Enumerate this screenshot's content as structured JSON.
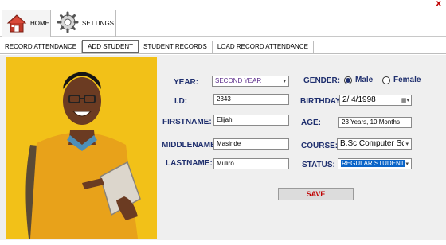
{
  "window": {
    "close_glyph": "x"
  },
  "ribbon": {
    "tabs": [
      {
        "label": "HOME",
        "icon": "house-icon"
      },
      {
        "label": "SETTINGS",
        "icon": "gear-icon"
      }
    ]
  },
  "subtabs": [
    {
      "label": "RECORD ATTENDANCE"
    },
    {
      "label": "ADD STUDENT",
      "active": true
    },
    {
      "label": "STUDENT RECORDS"
    },
    {
      "label": "LOAD RECORD ATTENDANCE"
    }
  ],
  "form": {
    "year": {
      "label": "YEAR:",
      "value": "SECOND YEAR"
    },
    "id": {
      "label": "I.D:",
      "value": "2343"
    },
    "firstname": {
      "label": "FIRSTNAME:",
      "value": "Elijah"
    },
    "middlename": {
      "label": "MIDDLENAME:",
      "value": "Masinde"
    },
    "lastname": {
      "label": "LASTNAME:",
      "value": "Muliro"
    },
    "gender": {
      "label": "GENDER:",
      "options": [
        "Male",
        "Female"
      ],
      "selected": "Male"
    },
    "birthday": {
      "label": "BIRTHDAY:",
      "value": "2/  4/1998"
    },
    "age": {
      "label": "AGE:",
      "value": "23 Years, 10 Months"
    },
    "course": {
      "label": "COURSE:",
      "value": "B.Sc Computer Sc"
    },
    "status": {
      "label": "STATUS:",
      "value": "REGULAR STUDENT"
    },
    "save_label": "SAVE"
  },
  "colors": {
    "label": "#1f2f6e",
    "save_text": "#c00000",
    "photo_bg": "#f2c118",
    "status_highlight": "#0a64c8"
  }
}
